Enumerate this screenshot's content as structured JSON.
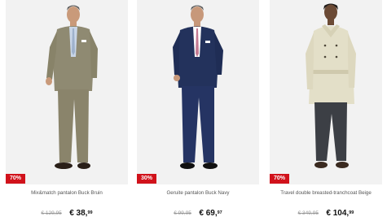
{
  "products": [
    {
      "discount": "70%",
      "name": "Mix&match pantalon Buck Bruin",
      "old_price": "€ 129,95",
      "price_main": "€ 38,",
      "price_cents": "99"
    },
    {
      "discount": "30%",
      "name": "Geruite pantalon Buck Navy",
      "old_price": "€ 99,95",
      "price_main": "€ 69,",
      "price_cents": "97"
    },
    {
      "discount": "70%",
      "name": "Travel double breasted-tranchcoat Beige",
      "old_price": "€ 349,95",
      "price_main": "€ 104,",
      "price_cents": "99"
    }
  ],
  "colors": {
    "badge": "#d1121b",
    "photo_bg": "#f2f2f2"
  }
}
